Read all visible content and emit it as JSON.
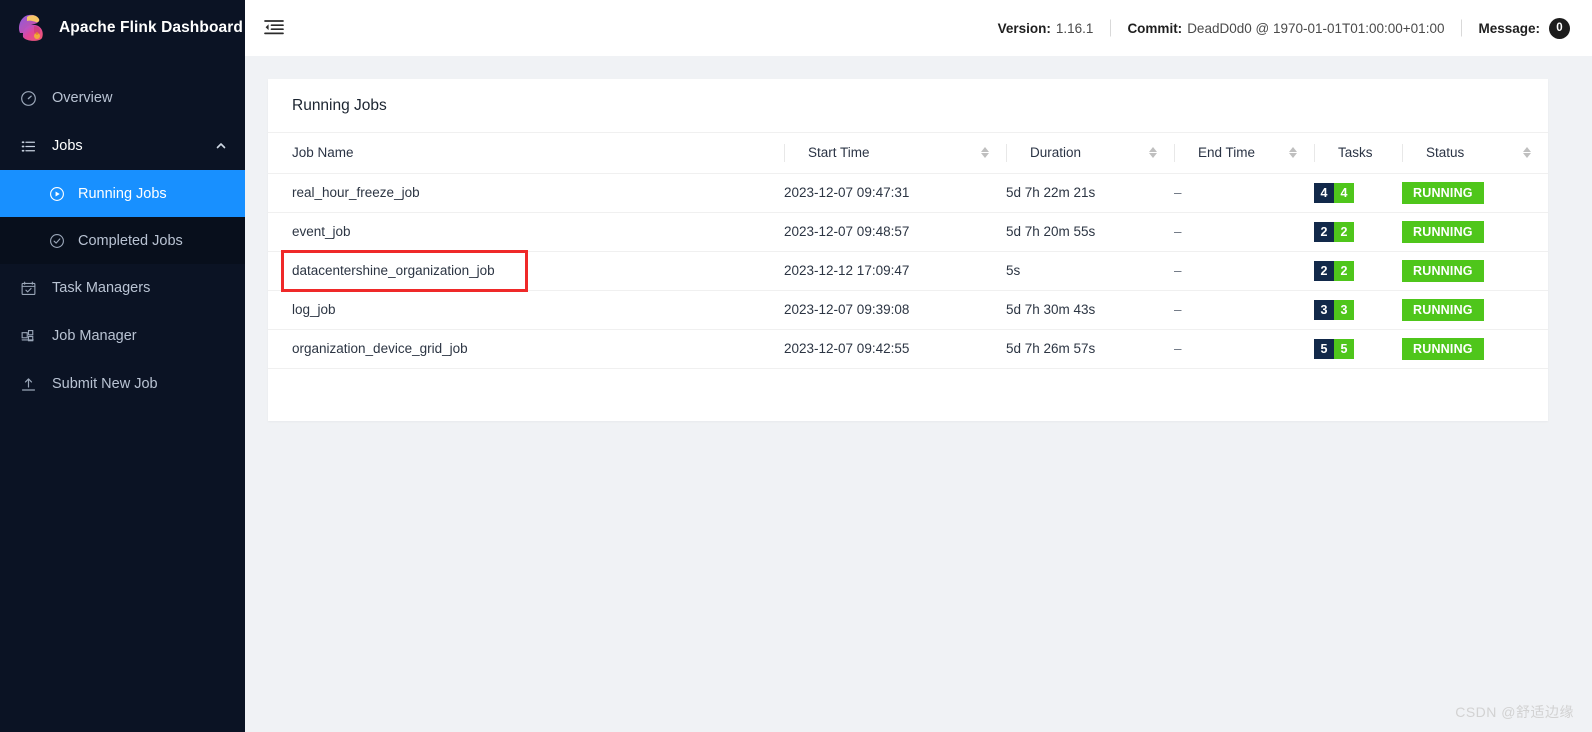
{
  "sidebar": {
    "brand": {
      "title": "Apache Flink Dashboard",
      "logo_icon": "flink-squirrel-logo"
    },
    "items": [
      {
        "label": "Overview",
        "icon": "dashboard-icon",
        "active": false
      },
      {
        "label": "Jobs",
        "icon": "list-icon",
        "active": false,
        "expanded": true
      },
      {
        "label": "Task Managers",
        "icon": "calendar-check-icon",
        "active": false
      },
      {
        "label": "Job Manager",
        "icon": "blocks-icon",
        "active": false
      },
      {
        "label": "Submit New Job",
        "icon": "upload-icon",
        "active": false
      }
    ],
    "jobs_submenu": [
      {
        "label": "Running Jobs",
        "icon": "play-circle-icon",
        "active": true
      },
      {
        "label": "Completed Jobs",
        "icon": "check-circle-icon",
        "active": false
      }
    ]
  },
  "topbar": {
    "collapse_icon": "menu-fold-icon",
    "version_label": "Version:",
    "version_value": "1.16.1",
    "commit_label": "Commit:",
    "commit_value": "DeadD0d0 @ 1970-01-01T01:00:00+01:00",
    "message_label": "Message:",
    "message_count": "0"
  },
  "panel": {
    "title": "Running Jobs"
  },
  "table": {
    "columns": [
      {
        "label": "Job Name",
        "sortable": false
      },
      {
        "label": "Start Time",
        "sortable": true
      },
      {
        "label": "Duration",
        "sortable": true
      },
      {
        "label": "End Time",
        "sortable": true
      },
      {
        "label": "Tasks",
        "sortable": false
      },
      {
        "label": "Status",
        "sortable": true
      }
    ],
    "rows": [
      {
        "job_name": "real_hour_freeze_job",
        "start_time": "2023-12-07 09:47:31",
        "duration": "5d 7h 22m 21s",
        "end_time": "–",
        "tasks_total": "4",
        "tasks_running": "4",
        "status": "RUNNING",
        "highlighted": false
      },
      {
        "job_name": "event_job",
        "start_time": "2023-12-07 09:48:57",
        "duration": "5d 7h 20m 55s",
        "end_time": "–",
        "tasks_total": "2",
        "tasks_running": "2",
        "status": "RUNNING",
        "highlighted": false
      },
      {
        "job_name": "datacentershine_organization_job",
        "start_time": "2023-12-12 17:09:47",
        "duration": "5s",
        "end_time": "–",
        "tasks_total": "2",
        "tasks_running": "2",
        "status": "RUNNING",
        "highlighted": true
      },
      {
        "job_name": "log_job",
        "start_time": "2023-12-07 09:39:08",
        "duration": "5d 7h 30m 43s",
        "end_time": "–",
        "tasks_total": "3",
        "tasks_running": "3",
        "status": "RUNNING",
        "highlighted": false
      },
      {
        "job_name": "organization_device_grid_job",
        "start_time": "2023-12-07 09:42:55",
        "duration": "5d 7h 26m 57s",
        "end_time": "–",
        "tasks_total": "5",
        "tasks_running": "5",
        "status": "RUNNING",
        "highlighted": false
      }
    ]
  },
  "watermark": "CSDN @舒适边缘",
  "colors": {
    "sidebar_bg": "#0b1324",
    "submenu_bg": "#080f1c",
    "active_blue": "#1890ff",
    "status_green": "#4fc61b",
    "tasks_total_navy": "#12294a",
    "highlight_red": "#ef2929",
    "page_bg": "#f0f2f5"
  }
}
